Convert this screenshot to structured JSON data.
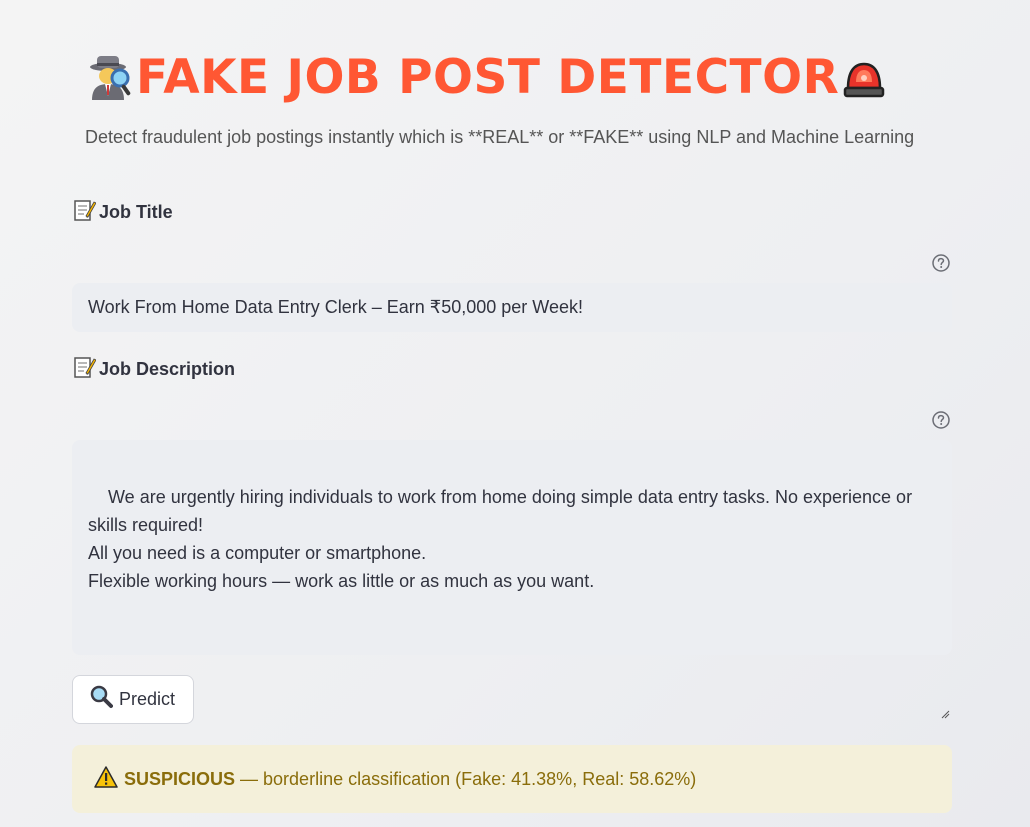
{
  "header": {
    "title": "FAKE JOB POST DETECTOR",
    "title_color": "#ff5733",
    "left_icon": "detective-icon",
    "right_icon": "siren-icon",
    "subtitle": "Detect fraudulent job postings instantly which is **REAL** or **FAKE** using NLP and Machine Learning"
  },
  "job_title": {
    "label": "Job Title",
    "icon": "memo-icon",
    "help_icon": "question-icon",
    "value": "Work From Home Data Entry Clerk – Earn ₹50,000 per Week!"
  },
  "job_description": {
    "label": "Job Description",
    "icon": "memo-icon",
    "help_icon": "question-icon",
    "value": "We are urgently hiring individuals to work from home doing simple data entry tasks. No experience or\nskills required!\nAll you need is a computer or smartphone.\nFlexible working hours — work as little or as much as you want."
  },
  "predict_button": {
    "label": "Predict",
    "icon": "magnifier-icon"
  },
  "result": {
    "icon": "warning-icon",
    "status": "SUSPICIOUS",
    "message": " — borderline classification (Fake: 41.38%, Real: 58.62%)",
    "background_color": "#f4f0da",
    "text_color": "#8a6d0b"
  }
}
